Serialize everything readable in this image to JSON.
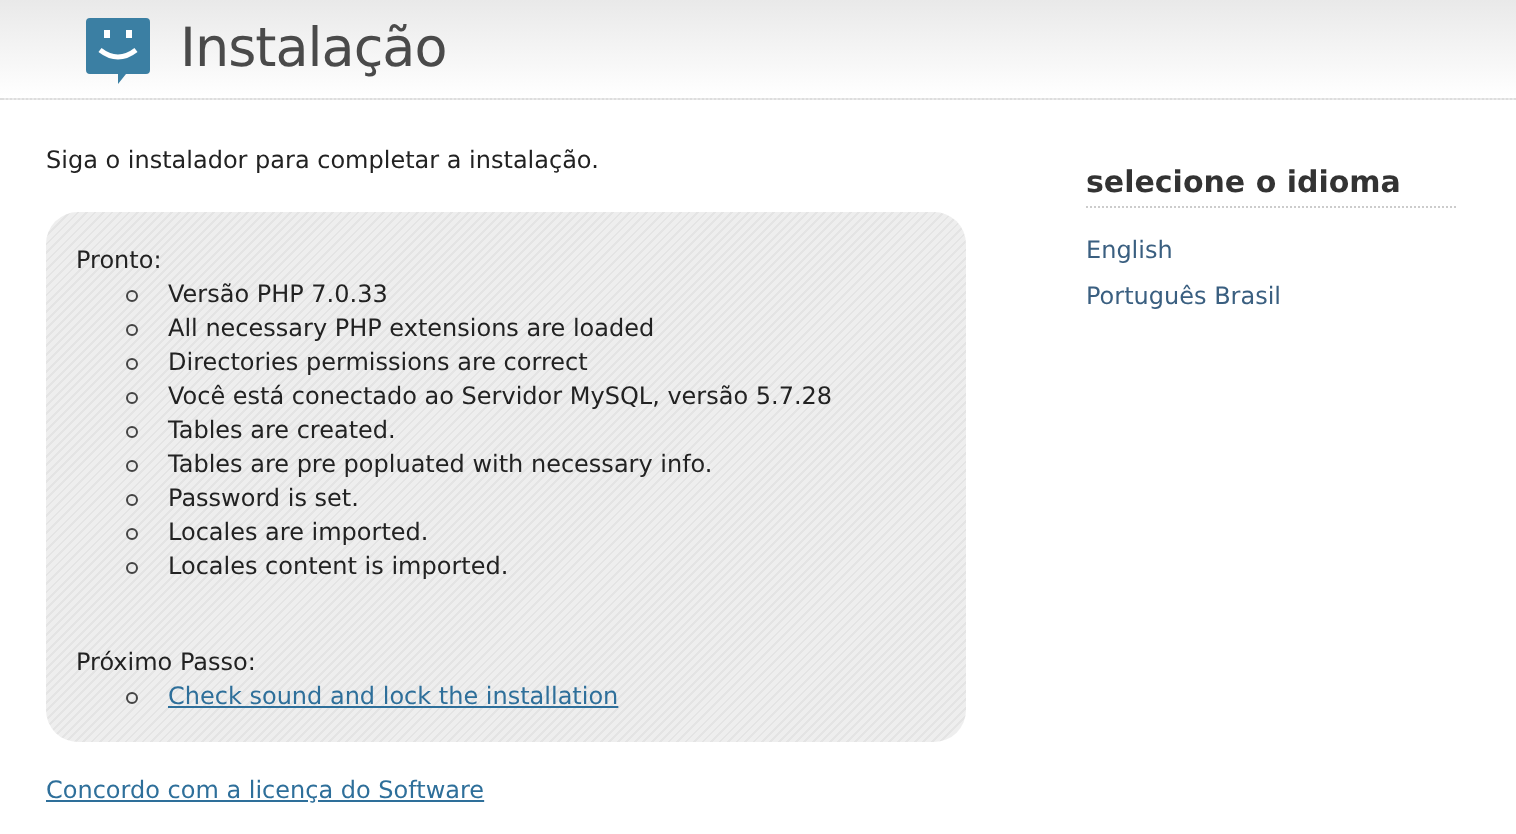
{
  "header": {
    "title": "Instalação"
  },
  "intro": "Siga o instalador para completar a instalação.",
  "status": {
    "heading": "Pronto:",
    "items": [
      "Versão PHP 7.0.33",
      "All necessary PHP extensions are loaded",
      "Directories permissions are correct",
      "Você está conectado ao Servidor MySQL, versão 5.7.28",
      "Tables are created.",
      "Tables are pre popluated with necessary info.",
      "Password is set.",
      "Locales are imported.",
      "Locales content is imported."
    ],
    "next_heading": "Próximo Passo:",
    "next_links": [
      "Check sound and lock the installation"
    ]
  },
  "license_link": "Concordo com a licença do Software",
  "sidebar": {
    "title": "selecione o idioma",
    "languages": [
      "English",
      "Português Brasil"
    ]
  }
}
